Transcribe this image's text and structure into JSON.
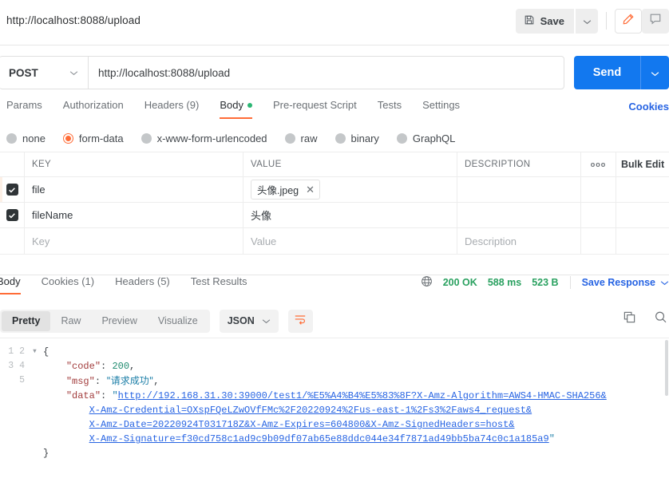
{
  "topbar": {
    "request_title": "http://localhost:8088/upload",
    "save_label": "Save",
    "save_icon": "floppy-disk-icon",
    "save_caret_icon": "chevron-down-icon",
    "edit_icon": "pencil-icon",
    "comment_icon": "comment-icon",
    "accent_orange": "#ff6c37"
  },
  "urlrow": {
    "method": "POST",
    "method_caret_icon": "chevron-down-icon",
    "url": "http://localhost:8088/upload",
    "send_label": "Send",
    "send_caret_icon": "chevron-down-icon",
    "send_color": "#1278ef"
  },
  "request_tabs": [
    {
      "label": "Params",
      "active": false,
      "dot": false
    },
    {
      "label": "Authorization",
      "active": false,
      "dot": false
    },
    {
      "label": "Headers (9)",
      "active": false,
      "dot": false
    },
    {
      "label": "Body",
      "active": true,
      "dot": true
    },
    {
      "label": "Pre-request Script",
      "active": false,
      "dot": false
    },
    {
      "label": "Tests",
      "active": false,
      "dot": false
    },
    {
      "label": "Settings",
      "active": false,
      "dot": false
    }
  ],
  "cookies_link": "Cookies",
  "body_types": [
    {
      "label": "none",
      "selected": false
    },
    {
      "label": "form-data",
      "selected": true
    },
    {
      "label": "x-www-form-urlencoded",
      "selected": false
    },
    {
      "label": "raw",
      "selected": false
    },
    {
      "label": "binary",
      "selected": false
    },
    {
      "label": "GraphQL",
      "selected": false
    }
  ],
  "kv_table": {
    "headers": {
      "key": "KEY",
      "value": "VALUE",
      "description": "DESCRIPTION",
      "more_icon": "ellipsis-icon",
      "bulk_edit": "Bulk Edit"
    },
    "rows": [
      {
        "checked": true,
        "key": "file",
        "value": "头像.jpeg",
        "is_file": true,
        "description": ""
      },
      {
        "checked": true,
        "key": "fileName",
        "value": "头像",
        "is_file": false,
        "description": ""
      }
    ],
    "placeholder_row": {
      "key": "Key",
      "value": "Value",
      "description": "Description"
    }
  },
  "response_tabs": [
    {
      "label": "Body",
      "active": true
    },
    {
      "label": "Cookies (1)",
      "active": false
    },
    {
      "label": "Headers (5)",
      "active": false
    },
    {
      "label": "Test Results",
      "active": false
    }
  ],
  "response_status": {
    "globe_icon": "globe-icon",
    "status": "200 OK",
    "time": "588 ms",
    "size": "523 B",
    "save_response": "Save Response",
    "save_response_caret_icon": "chevron-down-icon",
    "status_color": "#2aa160"
  },
  "viewer": {
    "modes": [
      {
        "label": "Pretty",
        "active": true
      },
      {
        "label": "Raw",
        "active": false
      },
      {
        "label": "Preview",
        "active": false
      },
      {
        "label": "Visualize",
        "active": false
      }
    ],
    "format": "JSON",
    "format_caret_icon": "chevron-down-icon",
    "wrap_icon": "word-wrap-icon",
    "copy_icon": "copy-icon",
    "search_icon": "search-icon"
  },
  "response_body": {
    "line_numbers": [
      "1",
      "2",
      "3",
      "4",
      "5"
    ],
    "brace_open": "{",
    "brace_close": "}",
    "code": {
      "code_key": "\"code\"",
      "code_value": "200",
      "msg_key": "\"msg\"",
      "msg_value": "\"请求成功\"",
      "data_key": "\"data\"",
      "data_value_lines": [
        "http://192.168.31.30:39000/test1/%E5%A4%B4%E5%83%8F?X-Amz-Algorithm=AWS4-HMAC-SHA256&",
        "X-Amz-Credential=OXspFQeLZwOVfFMc%2F20220924%2Fus-east-1%2Fs3%2Faws4_request&",
        "X-Amz-Date=20220924T031718Z&X-Amz-Expires=604800&X-Amz-SignedHeaders=host&",
        "X-Amz-Signature=f30cd758c1ad9c9b09df07ab65e88ddc044e34f7871ad49bb5ba74c0c1a185a9"
      ]
    }
  }
}
